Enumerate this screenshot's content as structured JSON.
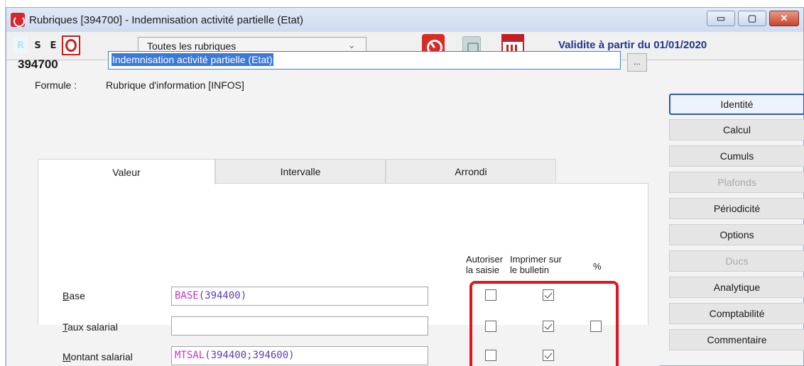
{
  "window": {
    "title": "Rubriques [394700] - Indemnisation activité partielle (Etat)",
    "controls": {
      "minimize": "▭",
      "restore": "▢",
      "close": "✕"
    }
  },
  "toolbar": {
    "letters": [
      "R",
      "S",
      "E"
    ],
    "filter_select": "Toutes les rubriques",
    "validity": "Validite à partir du 01/01/2020"
  },
  "header": {
    "code": "394700",
    "name": "Indemnisation activité partielle (Etat)",
    "more_button": "...",
    "formula_label": "Formule :",
    "formula_value": "Rubrique d'information [INFOS]"
  },
  "tabs": [
    {
      "label": "Valeur",
      "active": true
    },
    {
      "label": "Intervalle",
      "active": false
    },
    {
      "label": "Arrondi",
      "active": false
    }
  ],
  "columns": {
    "autoriser": [
      "Autoriser",
      "la saisie"
    ],
    "imprimer": [
      "Imprimer sur",
      "le bulletin"
    ],
    "percent": "%"
  },
  "rows": [
    {
      "accesskey": "B",
      "label_rest": "ase",
      "kw": "BASE",
      "args": "(394400)",
      "autoriser": false,
      "imprimer": true,
      "percent": null
    },
    {
      "accesskey": "T",
      "label_rest": "aux salarial",
      "kw": "",
      "args": "",
      "autoriser": false,
      "imprimer": true,
      "percent": false
    },
    {
      "accesskey": "M",
      "label_rest": "ontant salarial",
      "kw": "MTSAL",
      "args": "(394400;394600)",
      "autoriser": false,
      "imprimer": true,
      "percent": null
    }
  ],
  "nav": [
    {
      "label": "Identité",
      "state": "active"
    },
    {
      "label": "Calcul",
      "state": "normal"
    },
    {
      "label": "Cumuls",
      "state": "normal"
    },
    {
      "label": "Plafonds",
      "state": "disabled"
    },
    {
      "label": "Périodicité",
      "state": "normal"
    },
    {
      "label": "Options",
      "state": "normal"
    },
    {
      "label": "Ducs",
      "state": "disabled"
    },
    {
      "label": "Analytique",
      "state": "normal"
    },
    {
      "label": "Comptabilité",
      "state": "normal"
    },
    {
      "label": "Commentaire",
      "state": "normal"
    }
  ],
  "colors": {
    "accent": "#2c5aa8",
    "highlight": "#e0161b",
    "formula_keyword": "#cc33cc"
  }
}
